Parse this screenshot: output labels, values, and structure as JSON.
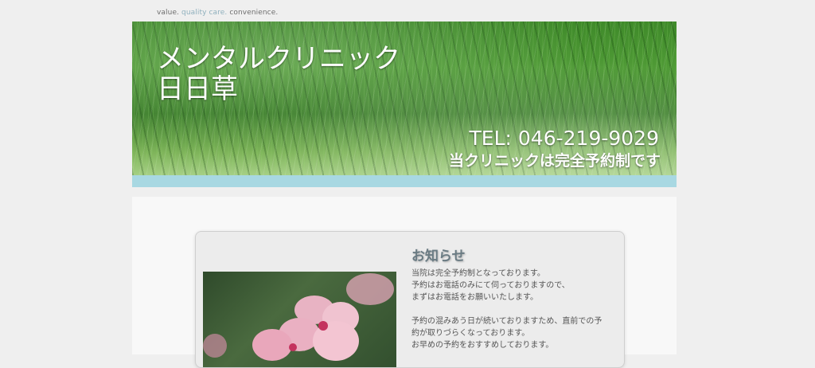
{
  "header": {
    "tagline": {
      "part1": "value.",
      "part2": "quality care.",
      "part3": "convenience."
    }
  },
  "hero": {
    "title_line1": "メンタルクリニック",
    "title_line2": "日日草",
    "tel": "TEL: 046-219-9029",
    "note": "当クリニックは完全予約制です"
  },
  "news": {
    "title": "お知らせ",
    "lines": [
      "当院は完全予約制となっております。",
      "予約はお電話のみにて伺っておりますので、",
      "まずはお電話をお願いいたします。",
      "予約の混みあう日が続いておりますため、直前での予",
      "約が取りづらくなっております。",
      "お早めの予約をおすすめしております。"
    ]
  },
  "colors": {
    "accent_bar": "#a8d8e2",
    "tagline_accent": "#8fb0bd",
    "page_background": "#efefef"
  }
}
